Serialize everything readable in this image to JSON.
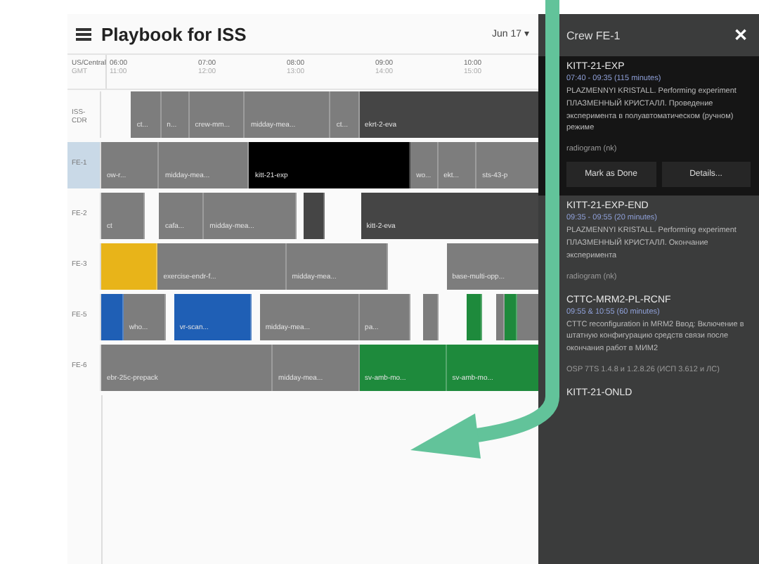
{
  "header": {
    "title": "Playbook for ISS",
    "date": "Jun 17 ▾"
  },
  "timezones": {
    "local": "US/Central",
    "utc": "GMT"
  },
  "ticks": [
    {
      "local": "06:00",
      "utc": "11:00"
    },
    {
      "local": "07:00",
      "utc": "12:00"
    },
    {
      "local": "08:00",
      "utc": "13:00"
    },
    {
      "local": "09:00",
      "utc": "14:00"
    },
    {
      "local": "10:00",
      "utc": "15:00"
    }
  ],
  "rows": [
    {
      "label": "ISS-CDR",
      "selected": false,
      "bars": [
        {
          "label": "ct...",
          "color": "#7d7d7d"
        },
        {
          "label": "n...",
          "color": "#7d7d7d"
        },
        {
          "label": "crew-mm...",
          "color": "#7d7d7d"
        },
        {
          "label": "midday-mea...",
          "color": "#7d7d7d"
        },
        {
          "label": "ct...",
          "color": "#7d7d7d"
        },
        {
          "label": "ekrt-2-eva",
          "color": "#454545"
        }
      ]
    },
    {
      "label": "FE-1",
      "selected": true,
      "bars": [
        {
          "label": "ow-r...",
          "color": "#7d7d7d"
        },
        {
          "label": "midday-mea...",
          "color": "#7d7d7d"
        },
        {
          "label": "kitt-21-exp",
          "color": "#000000"
        },
        {
          "label": "wo...",
          "color": "#7d7d7d"
        },
        {
          "label": "ekt...",
          "color": "#7d7d7d"
        },
        {
          "label": "sts-43-p",
          "color": "#7d7d7d"
        }
      ]
    },
    {
      "label": "FE-2",
      "selected": false,
      "bars": [
        {
          "label": "ct",
          "color": "#7d7d7d"
        },
        {
          "label": "cafa...",
          "color": "#7d7d7d"
        },
        {
          "label": "midday-mea...",
          "color": "#7d7d7d"
        },
        {
          "color": "#454545"
        },
        {
          "label": "kitt-2-eva",
          "color": "#454545"
        }
      ]
    },
    {
      "label": "FE-3",
      "selected": false,
      "bars": [
        {
          "color": "#e8b419"
        },
        {
          "label": "exercise-endr-f...",
          "color": "#7d7d7d"
        },
        {
          "label": "midday-mea...",
          "color": "#7d7d7d"
        },
        {
          "label": "base-multi-opp...",
          "color": "#7d7d7d"
        }
      ]
    },
    {
      "label": "FE-5",
      "selected": false,
      "bars": [
        {
          "color": "#1f5fb5"
        },
        {
          "label": "who...",
          "color": "#7d7d7d"
        },
        {
          "label": "vr-scan...",
          "color": "#1f5fb5"
        },
        {
          "label": "midday-mea...",
          "color": "#7d7d7d"
        },
        {
          "label": "pa...",
          "color": "#7d7d7d"
        },
        {
          "color": "#7d7d7d"
        },
        {
          "color": "#1e8a3c"
        },
        {
          "color": "#7d7d7d"
        },
        {
          "color": "#1e8a3c"
        },
        {
          "color": "#7d7d7d"
        }
      ]
    },
    {
      "label": "FE-6",
      "selected": false,
      "bars": [
        {
          "label": "ebr-25c-prepack",
          "color": "#7d7d7d"
        },
        {
          "label": "midday-mea...",
          "color": "#7d7d7d"
        },
        {
          "label": "sv-amb-mo...",
          "color": "#1e8a3c"
        },
        {
          "label": "sv-amb-mo...",
          "color": "#1e8a3c"
        }
      ]
    }
  ],
  "panel": {
    "title": "Crew FE-1",
    "close": "✕",
    "cards": [
      {
        "selected": true,
        "title": "KITT-21-EXP",
        "time": "07:40 - 09:35 (115 minutes)",
        "description": "PLAZMENNYI KRISTALL. Performing experiment ПЛАЗМЕННЫЙ КРИСТАЛЛ. Проведение эксперимента в полуавтоматическом (ручном) режиме",
        "note": "radiogram (nk)",
        "buttons": [
          "Mark as Done",
          "Details..."
        ]
      },
      {
        "selected": false,
        "title": "KITT-21-EXP-END",
        "time": "09:35 - 09:55 (20 minutes)",
        "description": "PLAZMENNYI KRISTALL. Performing experiment ПЛАЗМЕННЫЙ КРИСТАЛЛ. Окончание эксперимента",
        "note": "radiogram (nk)"
      },
      {
        "selected": false,
        "title": "CTTC-MRM2-PL-RCNF",
        "time": "09:55 & 10:55 (60 minutes)",
        "description": "CTTC reconfiguration in MRM2 Ввод: Включение в штатную конфигурацию средств связи после окончания работ в МИМ2",
        "note": "OSP 7TS 1.4.8 и 1.2.8.26 (ИСП 3.612 и ЛС)"
      },
      {
        "selected": false,
        "title": "KITT-21-ONLD"
      }
    ]
  }
}
